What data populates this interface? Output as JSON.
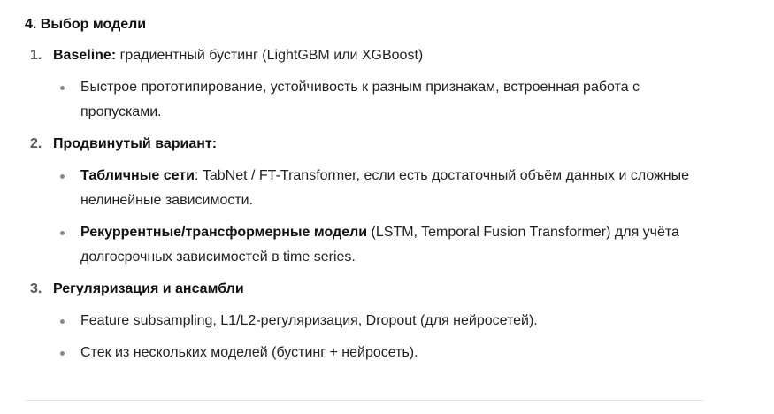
{
  "section": {
    "heading": "4. Выбор модели"
  },
  "items": [
    {
      "number": "1.",
      "label": "Baseline:",
      "text": " градиентный бустинг (LightGBM или XGBoost)",
      "bullets": [
        {
          "bold": "",
          "text": "Быстрое прототипирование, устойчивость к разным признакам, встроенная работа с пропусками."
        }
      ]
    },
    {
      "number": "2.",
      "label": "Продвинутый вариант:",
      "text": "",
      "bullets": [
        {
          "bold": "Табличные сети",
          "text": ": TabNet / FT-Transformer, если есть достаточный объём данных и сложные нелинейные зависимости."
        },
        {
          "bold": "Рекуррентные/трансформерные модели",
          "text": " (LSTM, Temporal Fusion Transformer) для учёта долгосрочных зависимостей в time series."
        }
      ]
    },
    {
      "number": "3.",
      "label": "Регуляризация и ансамбли",
      "text": "",
      "bullets": [
        {
          "bold": "",
          "text": "Feature subsampling, L1/L2-регуляризация, Dropout (для нейросетей)."
        },
        {
          "bold": "",
          "text": "Стек из нескольких моделей (бустинг + нейросеть)."
        }
      ]
    }
  ]
}
